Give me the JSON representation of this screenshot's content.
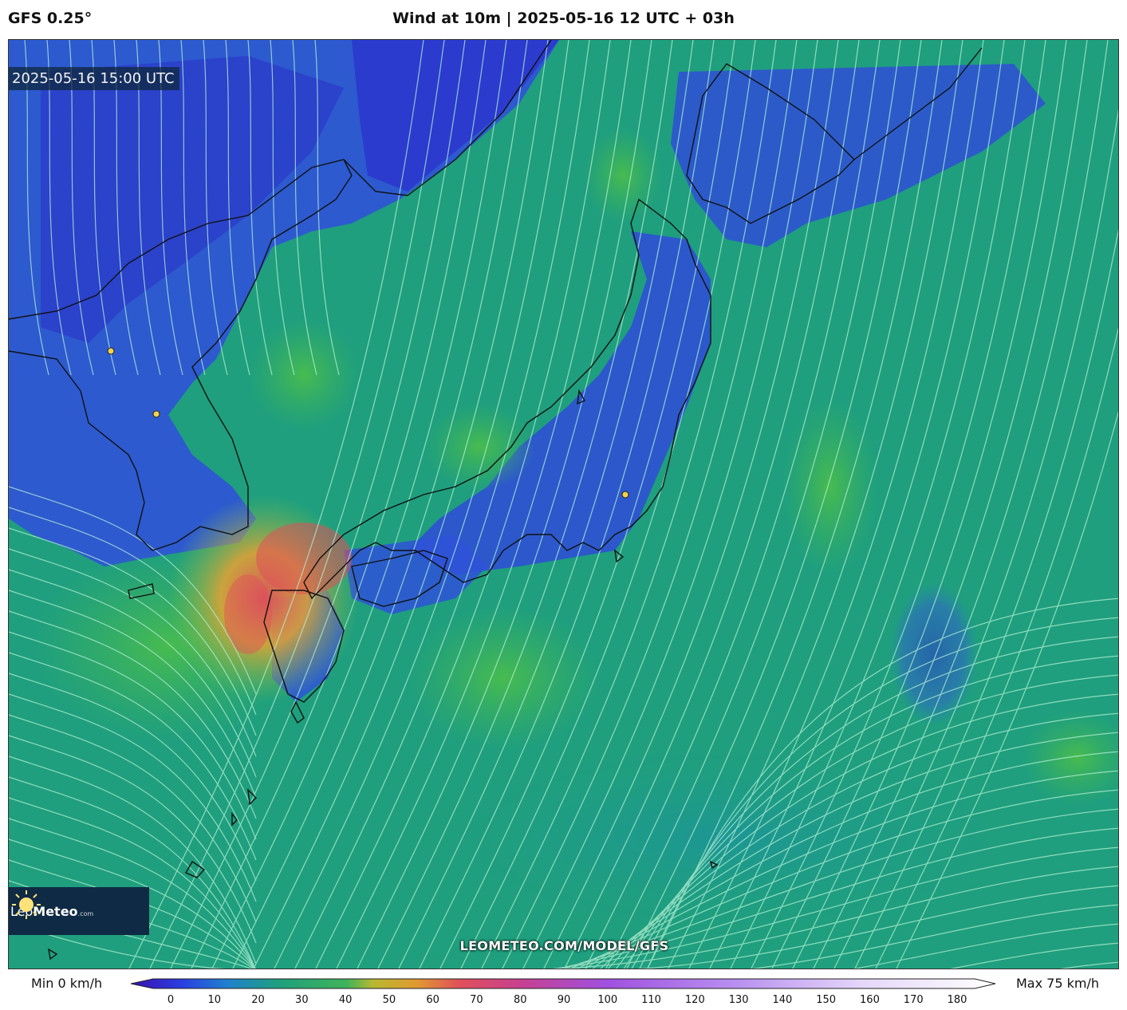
{
  "header": {
    "model": "GFS 0.25°",
    "title": "Wind at 10m | 2025-05-16 12 UTC + 03h"
  },
  "map": {
    "timestamp": "2025-05-16 15:00 UTC",
    "watermark": "LEOMETEO.COM/MODEL/GFS",
    "logo": {
      "name_part1": "Leo",
      "name_part2": "Meteo",
      "suffix": ".com"
    },
    "colors": {
      "calm": "#2c3fd6",
      "moderate": "#1f9f7e",
      "breezy": "#3fb35a",
      "strong": "#e0a030",
      "very_strong": "#e0505a",
      "streamline": "#b6f0d6",
      "coastline": "#111111"
    }
  },
  "legend": {
    "min_label": "Min 0 km/h",
    "max_label": "Max 75 km/h",
    "ticks": [
      "0",
      "10",
      "20",
      "30",
      "40",
      "50",
      "60",
      "70",
      "80",
      "90",
      "100",
      "110",
      "120",
      "130",
      "140",
      "150",
      "160",
      "170",
      "180"
    ]
  }
}
